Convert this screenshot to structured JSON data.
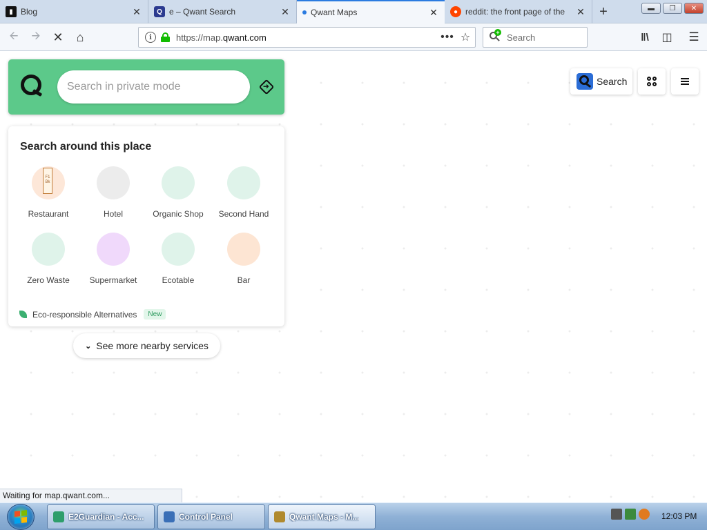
{
  "browser": {
    "tabs": [
      {
        "title": "Blog",
        "favicon": "blog-favicon-icon",
        "active": false
      },
      {
        "title": "e – Qwant Search",
        "favicon": "qwant-favicon-icon",
        "active": false
      },
      {
        "title": "Qwant Maps",
        "favicon": "loading-dot-icon",
        "active": true
      },
      {
        "title": "reddit: the front page of the",
        "favicon": "reddit-favicon-icon",
        "active": false
      }
    ],
    "new_tab_label": "+",
    "url_host_prefix": "https://map.",
    "url_host_domain": "qwant.com",
    "search_placeholder": "Search",
    "status_text": "Waiting for map.qwant.com..."
  },
  "qwant": {
    "search_placeholder": "Search in private mode",
    "around_title": "Search around this place",
    "categories": [
      {
        "label": "Restaurant",
        "color": "#fde7d8"
      },
      {
        "label": "Hotel",
        "color": "#ececec"
      },
      {
        "label": "Organic Shop",
        "color": "#dff3ea"
      },
      {
        "label": "Second Hand",
        "color": "#dff3ea"
      },
      {
        "label": "Zero Waste",
        "color": "#dff3ea"
      },
      {
        "label": "Supermarket",
        "color": "#f0d9fb"
      },
      {
        "label": "Ecotable",
        "color": "#dff3ea"
      },
      {
        "label": "Bar",
        "color": "#fde5d3"
      }
    ],
    "restaurant_menu_text": "F1 Bk",
    "eco_label": "Eco-responsible Alternatives",
    "eco_badge": "New",
    "see_more_label": "See more nearby services",
    "top_search_label": "Search",
    "accent_color": "#5cc98a"
  },
  "taskbar": {
    "items": [
      {
        "label": "E2Guardian - Acc...",
        "active": false,
        "icon_color": "#2e9e6b"
      },
      {
        "label": "Control Panel",
        "active": false,
        "icon_color": "#3a6fb7"
      },
      {
        "label": "Qwant Maps - M...",
        "active": true,
        "icon_color": "#b08a2e"
      }
    ],
    "clock": "12:03 PM"
  }
}
